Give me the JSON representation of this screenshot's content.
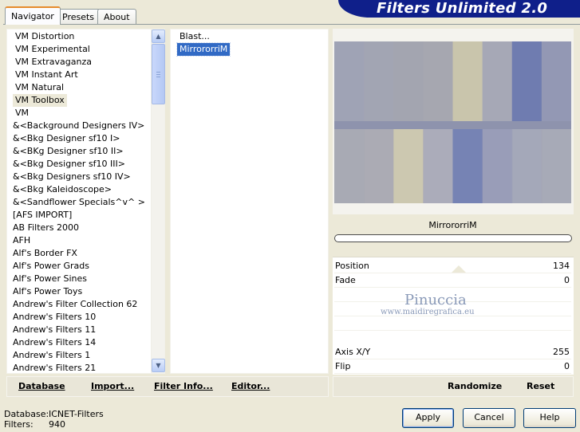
{
  "tabs": [
    {
      "label": "Navigator",
      "active": true
    },
    {
      "label": "Presets",
      "active": false
    },
    {
      "label": "About",
      "active": false
    }
  ],
  "title": "Filters Unlimited 2.0",
  "categories": [
    "VM Distortion",
    "VM Experimental",
    "VM Extravaganza",
    "VM Instant Art",
    "VM Natural",
    "VM Toolbox",
    "VM",
    "&<Background Designers IV>",
    "&<Bkg Designer sf10 I>",
    "&<BKg Designer sf10 II>",
    "&<Bkg Designer sf10 III>",
    "&<Bkg Designers sf10 IV>",
    "&<Bkg Kaleidoscope>",
    "&<Sandflower Specials^v^ >",
    "[AFS IMPORT]",
    "AB Filters 2000",
    "AFH",
    "Alf's Border FX",
    "Alf's Power Grads",
    "Alf's Power Sines",
    "Alf's Power Toys",
    "Andrew's Filter Collection 62",
    "Andrew's Filters 10",
    "Andrew's Filters 11",
    "Andrew's Filters 14",
    "Andrew's Filters 1",
    "Andrew's Filters 21"
  ],
  "selected_category": "VM Toolbox",
  "filters": [
    "Blast...",
    "MirrororriM"
  ],
  "selected_filter": "MirrororriM",
  "preview": {
    "colors": [
      "#9fa3b5",
      "#a2a5b3",
      "#a3a5b0",
      "#a6a7b0",
      "#c9c5ac",
      "#a6a8b6",
      "#6f7cb0",
      "#9398b4"
    ]
  },
  "filter_name": "MirrororriM",
  "params": [
    {
      "label": "Position",
      "value": "134"
    },
    {
      "label": "Fade",
      "value": "0"
    },
    {
      "label": "",
      "value": ""
    },
    {
      "label": "",
      "value": ""
    },
    {
      "label": "",
      "value": ""
    },
    {
      "label": "Axis X/Y",
      "value": "255"
    },
    {
      "label": "Flip",
      "value": "0"
    }
  ],
  "watermark": {
    "line1": "Pinuccia",
    "line2": "www.maidiregrafica.eu"
  },
  "toolbar": {
    "database": "Database",
    "import": "Import...",
    "filter_info": "Filter Info...",
    "editor": "Editor...",
    "randomize": "Randomize",
    "reset": "Reset"
  },
  "status": {
    "database_label": "Database:",
    "database_value": "ICNET-Filters",
    "filters_label": "Filters:",
    "filters_value": "940"
  },
  "buttons": {
    "apply": "Apply",
    "cancel": "Cancel",
    "help": "Help"
  },
  "colors": {
    "banner": "#0f1f8a",
    "selection": "#316ac5",
    "tab_highlight": "#e68b2c"
  }
}
